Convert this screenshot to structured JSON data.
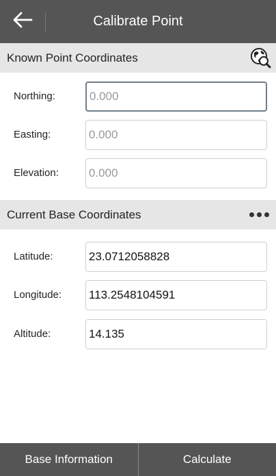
{
  "header": {
    "title": "Calibrate Point",
    "back_icon": "arrow-left-icon"
  },
  "known_section": {
    "title": "Known Point Coordinates",
    "icon": "globe-search-icon",
    "fields": [
      {
        "label": "Northing:",
        "value": "",
        "placeholder": "0.000"
      },
      {
        "label": "Easting:",
        "value": "",
        "placeholder": "0.000"
      },
      {
        "label": "Elevation:",
        "value": "",
        "placeholder": "0.000"
      }
    ]
  },
  "base_section": {
    "title": "Current Base Coordinates",
    "icon": "more-dots-icon",
    "fields": [
      {
        "label": "Latitude:",
        "value": "23.0712058828"
      },
      {
        "label": "Longitude:",
        "value": "113.2548104591"
      },
      {
        "label": "Altitude:",
        "value": "14.135"
      }
    ]
  },
  "footer": {
    "base_info_label": "Base Information",
    "calculate_label": "Calculate"
  },
  "colors": {
    "bar": "#555555",
    "section_bg": "#e6e6e6",
    "focus_border": "#6d7e8a"
  }
}
